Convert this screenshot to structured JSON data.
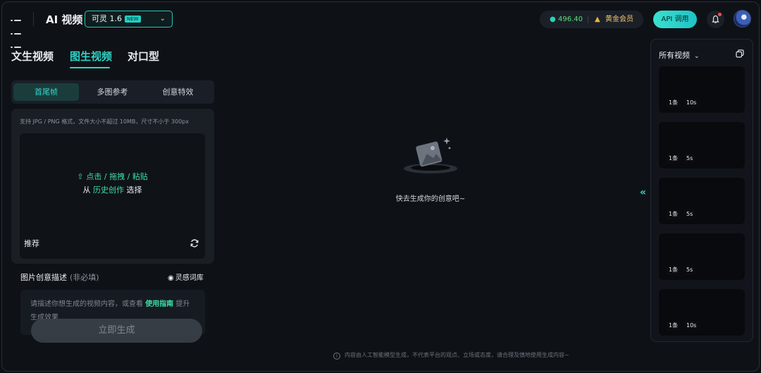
{
  "header": {
    "app_title": "AI 视频",
    "model": {
      "label": "可灵 1.6",
      "badge": "NEW"
    },
    "points": "496.40",
    "membership": "黄金会员",
    "api_button": "API 调用"
  },
  "tabs": [
    "文生视频",
    "图生视频",
    "对口型"
  ],
  "active_tab": "图生视频",
  "subtabs": [
    "首尾帧",
    "多图参考",
    "创意特效"
  ],
  "upload": {
    "hint": "支持 JPG / PNG 格式，文件大小不超过 10MB，尺寸不小于 300px",
    "action": "点击 / 拖拽 / 粘贴",
    "from_prefix": "从",
    "history_link": "历史创作",
    "select": "选择",
    "recommend": "推荐"
  },
  "description": {
    "label": "图片创意描述",
    "optional": "(非必填)",
    "inspiration": "灵感词库",
    "placeholder_a": "请描述你想生成的视频内容，或查看",
    "placeholder_link": "使用指南",
    "placeholder_b": "提升生成效果"
  },
  "generate_button": "立即生成",
  "empty_state": "快去生成你的创意吧~",
  "footer_note": "内容由人工智能模型生成，不代表平台的观点、立场或态度，请合理及慎地使用生成内容~",
  "right_panel": {
    "title": "所有视频",
    "videos": [
      {
        "count": "1条",
        "duration": "10s"
      },
      {
        "count": "1条",
        "duration": "5s"
      },
      {
        "count": "1条",
        "duration": "5s"
      },
      {
        "count": "1条",
        "duration": "5s"
      },
      {
        "count": "1条",
        "duration": "10s"
      }
    ]
  },
  "colors": {
    "accent": "#2fd3c6",
    "highlight_green": "#3ddfa6",
    "points_green": "#5fdc7e",
    "gold": "#f2c66a"
  }
}
